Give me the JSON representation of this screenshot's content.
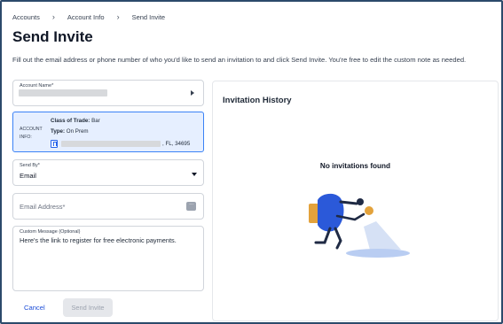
{
  "breadcrumb": {
    "items": [
      "Accounts",
      "Account Info",
      "Send Invite"
    ],
    "separator": "›"
  },
  "page": {
    "title": "Send Invite",
    "description": "Fill out the email address or phone number of who you'd like to send an invitation to and click Send Invite. You're free to edit the custom note as needed."
  },
  "form": {
    "account_name": {
      "label": "Account Name*",
      "value_redacted": true,
      "icon": "caret-right-icon"
    },
    "account_info": {
      "label": "ACCOUNT INFO:",
      "class_of_trade_label": "Class of Trade:",
      "class_of_trade_value": "Bar",
      "type_label": "Type:",
      "type_value": "On Prem",
      "address_suffix": ", FL, 34695",
      "icon": "bookmark-icon"
    },
    "send_by": {
      "label": "Send By*",
      "value": "Email",
      "icon": "chevron-down-icon"
    },
    "email": {
      "placeholder": "Email Address*",
      "icon": "dots-icon"
    },
    "custom_message": {
      "label": "Custom Message (Optional)",
      "value": "Here's the link to register for free electronic payments."
    }
  },
  "actions": {
    "cancel_label": "Cancel",
    "send_label": "Send Invite",
    "send_disabled": true
  },
  "history": {
    "title": "Invitation History",
    "empty_text": "No invitations found"
  },
  "colors": {
    "accent": "#1d4ed8",
    "info_bg": "#e6efff",
    "info_border": "#3b82f6",
    "frame_border": "#2c4a6b",
    "illustration_blue": "#2b59d9",
    "illustration_gold": "#e3a23b"
  }
}
